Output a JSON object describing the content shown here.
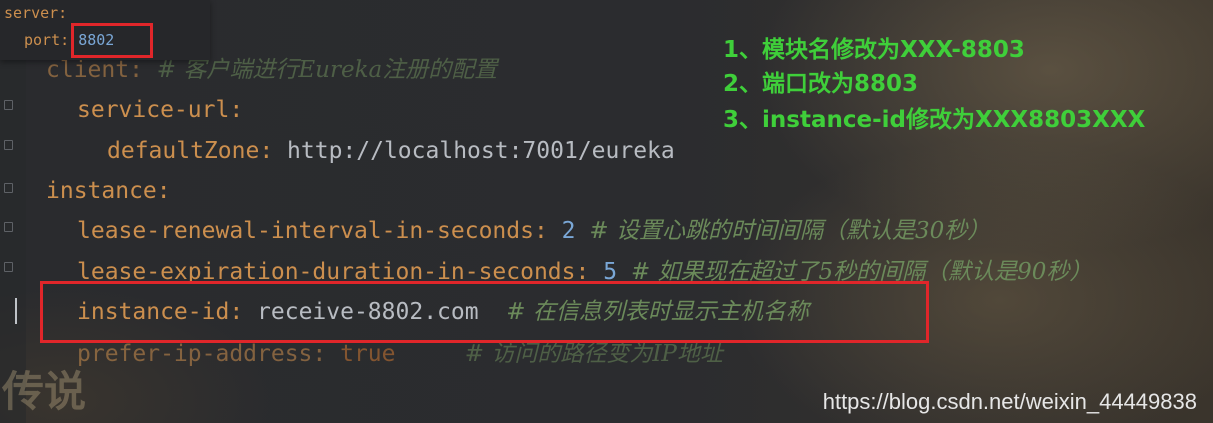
{
  "popup": {
    "server_key": "server:",
    "port_key": "port:",
    "port_value": "8802"
  },
  "code": {
    "client_key": "client:",
    "client_comment": "# 客户端进行Eureka注册的配置",
    "service_url_key": "service-url:",
    "default_zone_key": "defaultZone:",
    "default_zone_value": "http://localhost:7001/eureka",
    "instance_key": "instance:",
    "renewal_key": "lease-renewal-interval-in-seconds:",
    "renewal_value": "2",
    "renewal_comment": "# 设置心跳的时间间隔（默认是30秒）",
    "expiration_key": "lease-expiration-duration-in-seconds:",
    "expiration_value": "5",
    "expiration_comment": "# 如果现在超过了5秒的间隔（默认是90秒）",
    "instance_id_key": "instance-id:",
    "instance_id_value": "receive-8802.com",
    "instance_id_comment": "# 在信息列表时显示主机名称",
    "prefer_ip_key": "prefer-ip-address:",
    "prefer_ip_value": "true",
    "prefer_ip_comment": "# 访问的路径变为IP地址"
  },
  "notes": [
    "1、模块名修改为XXX-8803",
    "2、端口改为8803",
    "3、instance-id修改为XXX8803XXX"
  ],
  "background_text": "传说",
  "watermark": "https://blog.csdn.net/weixin_44449838",
  "colors": {
    "highlight_box": "#e0262a",
    "note_text": "#3fcf3a",
    "yaml_key": "#cc8f4e",
    "number": "#7aa7d6",
    "comment": "#6b8a5a"
  }
}
